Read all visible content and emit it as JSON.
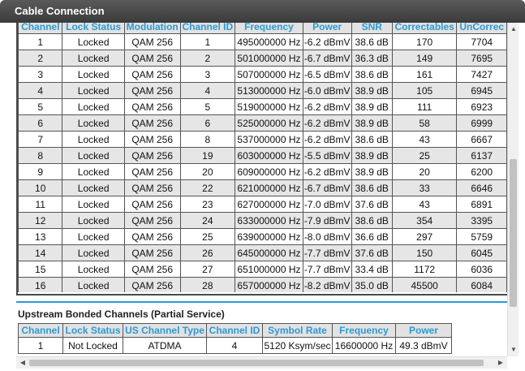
{
  "window": {
    "title": "Cable Connection"
  },
  "downstream": {
    "headers": [
      "Channel",
      "Lock Status",
      "Modulation",
      "Channel ID",
      "Frequency",
      "Power",
      "SNR",
      "Correctables",
      "UnCorrec"
    ],
    "rows": [
      [
        "1",
        "Locked",
        "QAM 256",
        "1",
        "495000000 Hz",
        "-6.2 dBmV",
        "38.6 dB",
        "170",
        "7704"
      ],
      [
        "2",
        "Locked",
        "QAM 256",
        "2",
        "501000000 Hz",
        "-6.7 dBmV",
        "36.3 dB",
        "149",
        "7695"
      ],
      [
        "3",
        "Locked",
        "QAM 256",
        "3",
        "507000000 Hz",
        "-6.5 dBmV",
        "38.6 dB",
        "161",
        "7427"
      ],
      [
        "4",
        "Locked",
        "QAM 256",
        "4",
        "513000000 Hz",
        "-6.0 dBmV",
        "38.9 dB",
        "105",
        "6945"
      ],
      [
        "5",
        "Locked",
        "QAM 256",
        "5",
        "519000000 Hz",
        "-6.2 dBmV",
        "38.9 dB",
        "111",
        "6923"
      ],
      [
        "6",
        "Locked",
        "QAM 256",
        "6",
        "525000000 Hz",
        "-6.2 dBmV",
        "38.9 dB",
        "58",
        "6999"
      ],
      [
        "7",
        "Locked",
        "QAM 256",
        "8",
        "537000000 Hz",
        "-6.2 dBmV",
        "38.6 dB",
        "43",
        "6667"
      ],
      [
        "8",
        "Locked",
        "QAM 256",
        "19",
        "603000000 Hz",
        "-5.5 dBmV",
        "38.9 dB",
        "25",
        "6137"
      ],
      [
        "9",
        "Locked",
        "QAM 256",
        "20",
        "609000000 Hz",
        "-6.2 dBmV",
        "38.9 dB",
        "20",
        "6200"
      ],
      [
        "10",
        "Locked",
        "QAM 256",
        "22",
        "621000000 Hz",
        "-6.7 dBmV",
        "38.6 dB",
        "33",
        "6646"
      ],
      [
        "11",
        "Locked",
        "QAM 256",
        "23",
        "627000000 Hz",
        "-7.0 dBmV",
        "37.6 dB",
        "43",
        "6891"
      ],
      [
        "12",
        "Locked",
        "QAM 256",
        "24",
        "633000000 Hz",
        "-7.9 dBmV",
        "38.6 dB",
        "354",
        "3395"
      ],
      [
        "13",
        "Locked",
        "QAM 256",
        "25",
        "639000000 Hz",
        "-8.0 dBmV",
        "36.6 dB",
        "297",
        "5759"
      ],
      [
        "14",
        "Locked",
        "QAM 256",
        "26",
        "645000000 Hz",
        "-7.7 dBmV",
        "37.6 dB",
        "150",
        "6045"
      ],
      [
        "15",
        "Locked",
        "QAM 256",
        "27",
        "651000000 Hz",
        "-7.7 dBmV",
        "33.4 dB",
        "1172",
        "6036"
      ],
      [
        "16",
        "Locked",
        "QAM 256",
        "28",
        "657000000 Hz",
        "-8.2 dBmV",
        "35.0 dB",
        "45500",
        "6084"
      ]
    ]
  },
  "upstream": {
    "heading": "Upstream Bonded Channels (Partial Service)",
    "headers": [
      "Channel",
      "Lock Status",
      "US Channel Type",
      "Channel ID",
      "Symbol Rate",
      "Frequency",
      "Power"
    ],
    "rows": [
      [
        "1",
        "Not Locked",
        "ATDMA",
        "4",
        "5120 Ksym/sec",
        "16600000 Hz",
        "49.3 dBmV"
      ]
    ]
  },
  "scrollbars": {
    "up_arrow": "▲",
    "down_arrow": "▼",
    "left_arrow": "◀",
    "right_arrow": "▶"
  }
}
